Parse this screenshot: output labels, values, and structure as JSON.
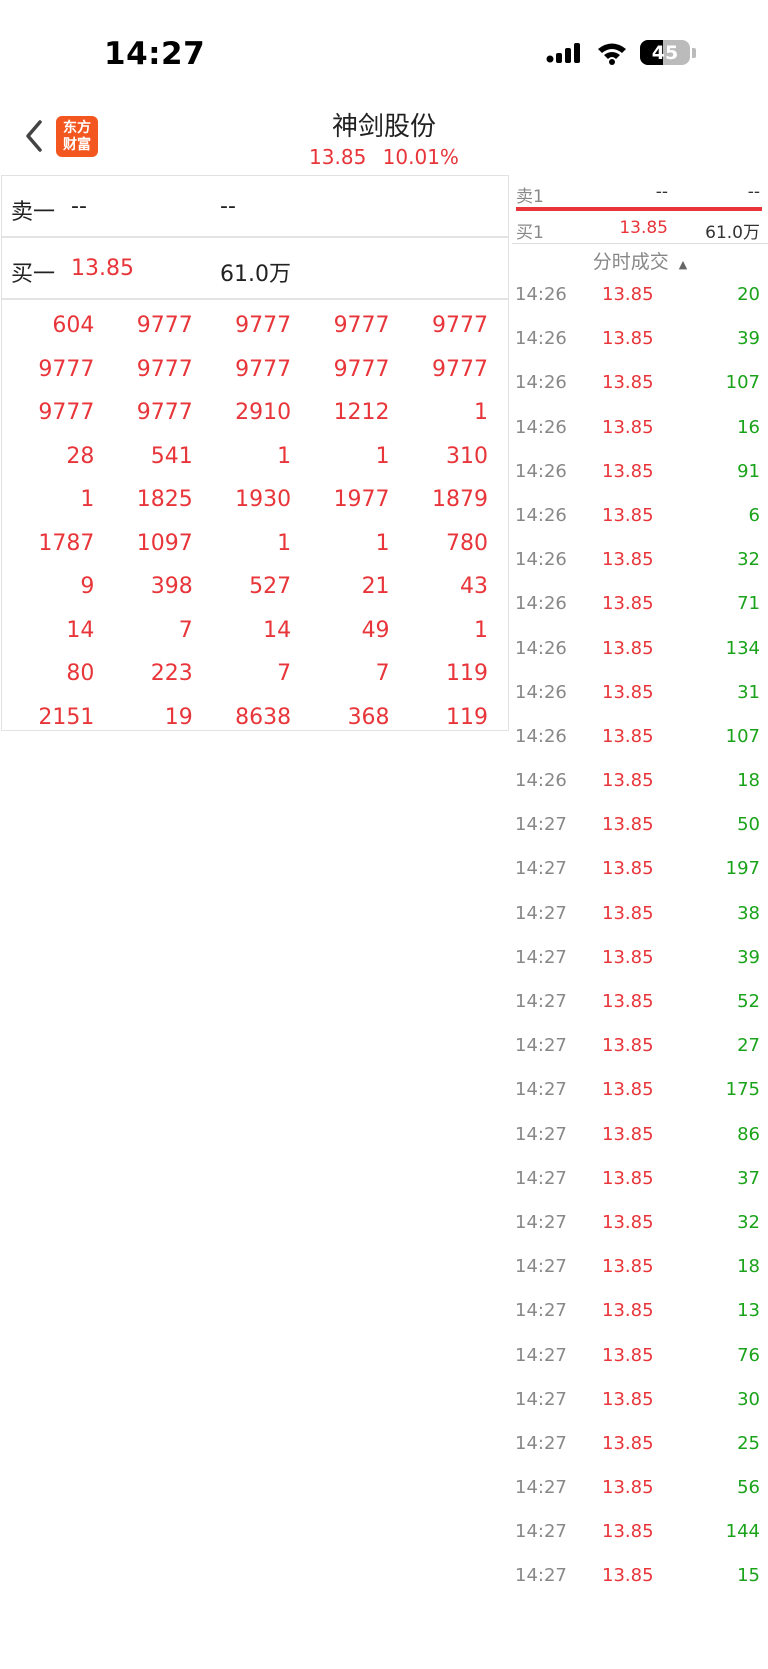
{
  "status": {
    "time": "14:27",
    "battery": "45",
    "battery_level": 0.45
  },
  "header": {
    "logo_line1": "东方",
    "logo_line2": "财富",
    "title": "神剑股份",
    "price": "13.85",
    "change_pct": "10.01%"
  },
  "left": {
    "sell_label": "卖一",
    "sell_price": "--",
    "sell_volume": "--",
    "buy_label": "买一",
    "buy_price": "13.85",
    "buy_volume": "61.0万",
    "orders": [
      [
        "604",
        "9777",
        "9777",
        "9777",
        "9777"
      ],
      [
        "9777",
        "9777",
        "9777",
        "9777",
        "9777"
      ],
      [
        "9777",
        "9777",
        "2910",
        "1212",
        "1"
      ],
      [
        "28",
        "541",
        "1",
        "1",
        "310"
      ],
      [
        "1",
        "1825",
        "1930",
        "1977",
        "1879"
      ],
      [
        "1787",
        "1097",
        "1",
        "1",
        "780"
      ],
      [
        "9",
        "398",
        "527",
        "21",
        "43"
      ],
      [
        "14",
        "7",
        "14",
        "49",
        "1"
      ],
      [
        "80",
        "223",
        "7",
        "7",
        "119"
      ],
      [
        "2151",
        "19",
        "8638",
        "368",
        "119"
      ]
    ]
  },
  "right": {
    "sell1_label": "卖1",
    "sell1_price": "--",
    "sell1_volume": "--",
    "buy1_label": "买1",
    "buy1_price": "13.85",
    "buy1_volume": "61.0万",
    "ticks_title": "分时成交",
    "ticks": [
      {
        "t": "14:26",
        "p": "13.85",
        "v": "20"
      },
      {
        "t": "14:26",
        "p": "13.85",
        "v": "39"
      },
      {
        "t": "14:26",
        "p": "13.85",
        "v": "107"
      },
      {
        "t": "14:26",
        "p": "13.85",
        "v": "16"
      },
      {
        "t": "14:26",
        "p": "13.85",
        "v": "91"
      },
      {
        "t": "14:26",
        "p": "13.85",
        "v": "6"
      },
      {
        "t": "14:26",
        "p": "13.85",
        "v": "32"
      },
      {
        "t": "14:26",
        "p": "13.85",
        "v": "71"
      },
      {
        "t": "14:26",
        "p": "13.85",
        "v": "134"
      },
      {
        "t": "14:26",
        "p": "13.85",
        "v": "31"
      },
      {
        "t": "14:26",
        "p": "13.85",
        "v": "107"
      },
      {
        "t": "14:26",
        "p": "13.85",
        "v": "18"
      },
      {
        "t": "14:27",
        "p": "13.85",
        "v": "50"
      },
      {
        "t": "14:27",
        "p": "13.85",
        "v": "197"
      },
      {
        "t": "14:27",
        "p": "13.85",
        "v": "38"
      },
      {
        "t": "14:27",
        "p": "13.85",
        "v": "39"
      },
      {
        "t": "14:27",
        "p": "13.85",
        "v": "52"
      },
      {
        "t": "14:27",
        "p": "13.85",
        "v": "27"
      },
      {
        "t": "14:27",
        "p": "13.85",
        "v": "175"
      },
      {
        "t": "14:27",
        "p": "13.85",
        "v": "86"
      },
      {
        "t": "14:27",
        "p": "13.85",
        "v": "37"
      },
      {
        "t": "14:27",
        "p": "13.85",
        "v": "32"
      },
      {
        "t": "14:27",
        "p": "13.85",
        "v": "18"
      },
      {
        "t": "14:27",
        "p": "13.85",
        "v": "13"
      },
      {
        "t": "14:27",
        "p": "13.85",
        "v": "76"
      },
      {
        "t": "14:27",
        "p": "13.85",
        "v": "30"
      },
      {
        "t": "14:27",
        "p": "13.85",
        "v": "25"
      },
      {
        "t": "14:27",
        "p": "13.85",
        "v": "56"
      },
      {
        "t": "14:27",
        "p": "13.85",
        "v": "144"
      },
      {
        "t": "14:27",
        "p": "13.85",
        "v": "15"
      }
    ]
  },
  "colors": {
    "up_red": "#e8353a",
    "down_green": "#1aa31a",
    "logo_orange": "#f3561f"
  }
}
